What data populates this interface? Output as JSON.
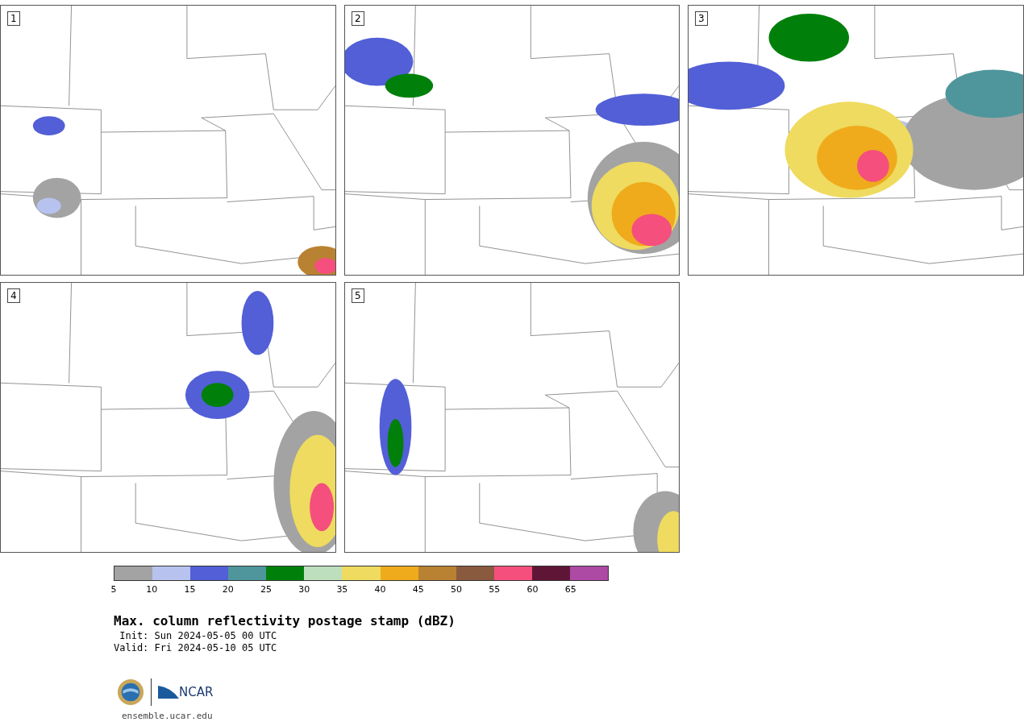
{
  "panels": [
    {
      "label": "1",
      "kind": "picture"
    },
    {
      "label": "2",
      "kind": "picture"
    },
    {
      "label": "3",
      "kind": "picture"
    },
    {
      "label": "4",
      "kind": "picture"
    },
    {
      "label": "5",
      "kind": "picture"
    }
  ],
  "colorbar": {
    "segments": [
      {
        "color": "#a3a3a3"
      },
      {
        "color": "#b7c3ee"
      },
      {
        "color": "#525fd7"
      },
      {
        "color": "#4e969c"
      },
      {
        "color": "#00800a"
      },
      {
        "color": "#bedfbd"
      },
      {
        "color": "#eedb5f"
      },
      {
        "color": "#efab1c"
      },
      {
        "color": "#b88232"
      },
      {
        "color": "#8a5a3e"
      },
      {
        "color": "#f54f7d"
      },
      {
        "color": "#5f1636"
      },
      {
        "color": "#ad4aa3"
      }
    ],
    "ticks": [
      "5",
      "10",
      "15",
      "20",
      "25",
      "30",
      "35",
      "40",
      "45",
      "50",
      "55",
      "60",
      "65"
    ]
  },
  "title": "Max. column reflectivity postage stamp (dBZ)",
  "init": " Init: Sun 2024-05-05 00 UTC",
  "valid": "Valid: Fri 2024-05-10 05 UTC",
  "logo": {
    "text": "NCAR",
    "url": "ensemble.ucar.edu"
  }
}
